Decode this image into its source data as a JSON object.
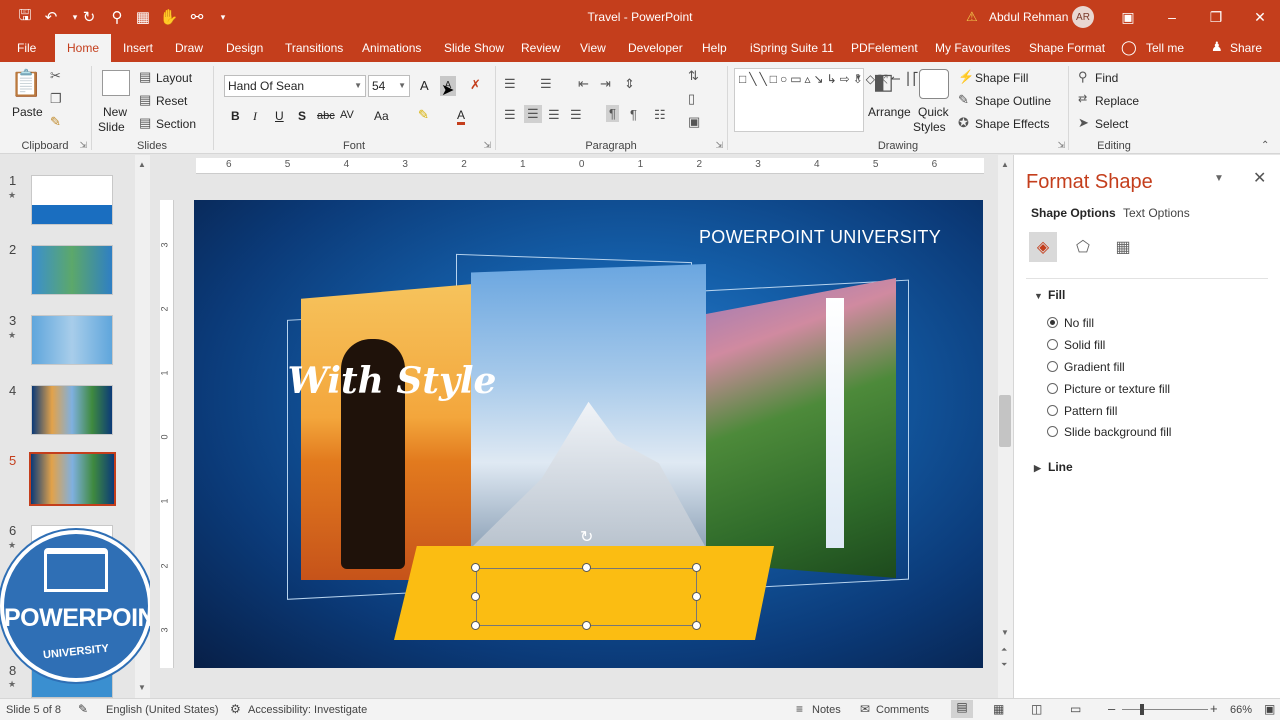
{
  "window": {
    "title": "Travel  -  PowerPoint",
    "user_name": "Abdul Rehman",
    "user_initials": "AR",
    "qat": [
      "save-icon",
      "undo-icon",
      "redo-icon",
      "repeat-icon",
      "present-icon",
      "touch-icon",
      "print-preview-icon",
      "customize-icon"
    ],
    "controls": [
      "ribbon-display-icon",
      "minimize-icon",
      "restore-icon",
      "close-icon"
    ]
  },
  "tabs": [
    "File",
    "Home",
    "Insert",
    "Draw",
    "Design",
    "Transitions",
    "Animations",
    "Slide Show",
    "Review",
    "View",
    "Developer",
    "Help",
    "iSpring Suite 11",
    "PDFelement",
    "My Favourites",
    "Shape Format",
    "Tell me",
    "Share"
  ],
  "active_tab": "Home",
  "ribbon": {
    "clipboard": {
      "label": "Clipboard",
      "paste": "Paste"
    },
    "slides": {
      "label": "Slides",
      "new_slide_1": "New",
      "new_slide_2": "Slide",
      "layout": "Layout",
      "reset": "Reset",
      "section": "Section"
    },
    "font": {
      "label": "Font",
      "font_name": "Hand Of Sean",
      "font_size": "54",
      "bold": "B",
      "italic": "I",
      "underline": "U",
      "shadow": "S",
      "strike": "abc",
      "spacing": "AV",
      "case": "Aa",
      "color": "A",
      "grow": "A",
      "shrink": "A"
    },
    "paragraph": {
      "label": "Paragraph"
    },
    "drawing": {
      "label": "Drawing",
      "arrange": "Arrange",
      "quick_styles_1": "Quick",
      "quick_styles_2": "Styles",
      "shape_fill": "Shape Fill",
      "shape_outline": "Shape Outline",
      "shape_effects": "Shape Effects"
    },
    "editing": {
      "label": "Editing",
      "find": "Find",
      "replace": "Replace",
      "select": "Select"
    }
  },
  "rulers": {
    "h_ticks": [
      "6",
      "5",
      "4",
      "3",
      "2",
      "1",
      "0",
      "1",
      "2",
      "3",
      "4",
      "5",
      "6"
    ],
    "v_ticks": [
      "3",
      "2",
      "1",
      "0",
      "1",
      "2",
      "3"
    ]
  },
  "thumbnails": [
    {
      "num": "1",
      "star": true
    },
    {
      "num": "2",
      "star": false
    },
    {
      "num": "3",
      "star": true
    },
    {
      "num": "4",
      "star": false
    },
    {
      "num": "5",
      "star": false,
      "selected": true
    },
    {
      "num": "6",
      "star": true
    },
    {
      "num": "8",
      "star": true
    }
  ],
  "logo": {
    "title": "POWERPOINT",
    "subtitle": "UNIVERSITY"
  },
  "slide": {
    "header": "POWERPOINT UNIVERSITY",
    "banner_text": "With Style",
    "banner_color": "#fbbd12",
    "photos": [
      "person-sunset-photo",
      "mountain-photo",
      "waterfall-photo"
    ]
  },
  "format_pane": {
    "title": "Format Shape",
    "tab_shape": "Shape Options",
    "tab_text": "Text Options",
    "icons": [
      "fill-line-icon",
      "effects-icon",
      "size-properties-icon"
    ],
    "fill_label": "Fill",
    "fill_options": [
      "No fill",
      "Solid fill",
      "Gradient fill",
      "Picture or texture fill",
      "Pattern fill",
      "Slide background fill"
    ],
    "fill_selected": "No fill",
    "line_label": "Line"
  },
  "status": {
    "slide_info": "Slide 5 of 8",
    "language": "English (United States)",
    "accessibility": "Accessibility: Investigate",
    "notes": "Notes",
    "comments": "Comments",
    "zoom": "66%"
  },
  "colors": {
    "accent": "#c43e1c",
    "banner": "#fbbd12",
    "slide_bg": "#0b3a78"
  }
}
